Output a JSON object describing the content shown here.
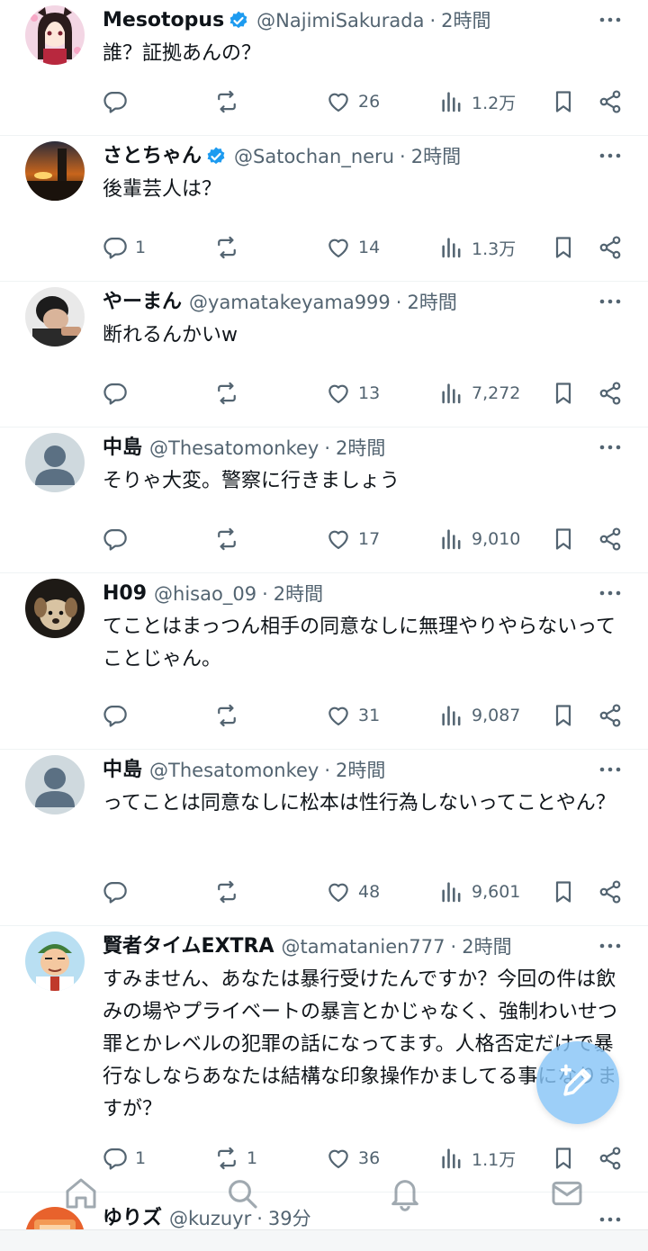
{
  "tweets": [
    {
      "display_name": "Mesotopus",
      "verified": true,
      "handle": "@NajimiSakurada",
      "time": "2時間",
      "text": "誰？証拠あんの？",
      "replies": "",
      "retweets": "",
      "likes": "26",
      "views": "1.2万",
      "avatar": "anime-girl"
    },
    {
      "display_name": "さとちゃん",
      "verified": true,
      "handle": "@Satochan_neru",
      "time": "2時間",
      "text": "後輩芸人は？",
      "replies": "1",
      "retweets": "",
      "likes": "14",
      "views": "1.3万",
      "avatar": "sunset"
    },
    {
      "display_name": "やーまん",
      "verified": false,
      "handle": "@yamatakeyama999",
      "time": "2時間",
      "text": "断れるんかいw",
      "replies": "",
      "retweets": "",
      "likes": "13",
      "views": "7,272",
      "avatar": "person-photo"
    },
    {
      "display_name": "中島",
      "verified": false,
      "handle": "@Thesatomonkey",
      "time": "2時間",
      "text": "そりゃ大変。警察に行きましょう",
      "replies": "",
      "retweets": "",
      "likes": "17",
      "views": "9,010",
      "avatar": "default"
    },
    {
      "display_name": "H09",
      "verified": false,
      "handle": "@hisao_09",
      "time": "2時間",
      "text": "てことはまっつん相手の同意なしに無理やりやらないってことじゃん。",
      "replies": "",
      "retweets": "",
      "likes": "31",
      "views": "9,087",
      "avatar": "puppy"
    },
    {
      "display_name": "中島",
      "verified": false,
      "handle": "@Thesatomonkey",
      "time": "2時間",
      "text": "ってことは同意なしに松本は性行為しないってことやん？",
      "replies": "",
      "retweets": "",
      "likes": "48",
      "views": "9,601",
      "avatar": "default"
    },
    {
      "display_name": "賢者タイムEXTRA",
      "verified": false,
      "handle": "@tamatanien777",
      "time": "2時間",
      "text": "すみません、あなたは暴行受けたんですか？今回の件は飲みの場やプライベートの暴言とかじゃなく、強制わいせつ罪とかレベルの犯罪の話になってます。人格否定だけで暴行なしならあなたは結構な印象操作かましてる事になりますが？",
      "replies": "1",
      "retweets": "1",
      "likes": "36",
      "views": "1.1万",
      "avatar": "cartoon-man"
    },
    {
      "display_name": "ゆりズ",
      "verified": false,
      "handle": "@kuzuyr",
      "time": "39分",
      "text": "",
      "replies": "",
      "retweets": "",
      "likes": "",
      "views": "",
      "avatar": "orange"
    }
  ],
  "icons": {
    "reply": "reply-icon",
    "retweet": "retweet-icon",
    "like": "heart-icon",
    "views": "analytics-icon",
    "bookmark": "bookmark-icon",
    "share": "share-icon",
    "more": "more-icon",
    "verified": "verified-badge-icon",
    "compose": "compose-icon"
  },
  "nav": [
    "home-icon",
    "search-icon",
    "notifications-icon",
    "messages-icon"
  ],
  "colors": {
    "accent": "#1d9bf0",
    "text": "#0f1419",
    "muted": "#536471",
    "fab": "#87c4f6"
  }
}
